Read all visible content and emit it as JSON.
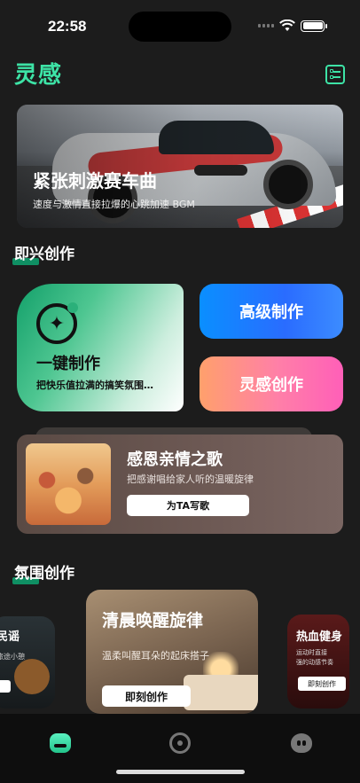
{
  "status": {
    "time": "22:58"
  },
  "header": {
    "title": "灵感",
    "action_icon": "checklist-icon"
  },
  "hero": {
    "title": "紧张刺激赛车曲",
    "subtitle": "速度与激情直接拉爆的心跳加速 BGM"
  },
  "sections": {
    "impromptu": "即兴创作",
    "mood": "氛围创作"
  },
  "one_click": {
    "title": "一键制作",
    "subtitle": "把快乐值拉满的搞笑氛围…",
    "icon": "sparkle-icon"
  },
  "buttons": {
    "advanced": "高级制作",
    "inspiration": "灵感创作"
  },
  "gift_card": {
    "title": "感恩亲情之歌",
    "subtitle": "把感谢唱给家人听的温暖旋律",
    "button": "为TA写歌"
  },
  "mood_cards": [
    {
      "title": "民谣",
      "subtitle": "旅途小憩",
      "button": ""
    },
    {
      "title": "清晨唤醒旋律",
      "subtitle": "温柔叫醒耳朵的起床搭子",
      "button": "即刻创作"
    },
    {
      "title": "热血健身",
      "subtitle_line1": "运动时直接",
      "subtitle_line2": "强的动感节奏",
      "button": "即刻创作"
    }
  ],
  "tabs": [
    {
      "name": "home",
      "active": true
    },
    {
      "name": "create",
      "active": false
    },
    {
      "name": "me",
      "active": false
    }
  ],
  "colors": {
    "accent": "#3de3a6",
    "background": "#1c1c1c"
  }
}
